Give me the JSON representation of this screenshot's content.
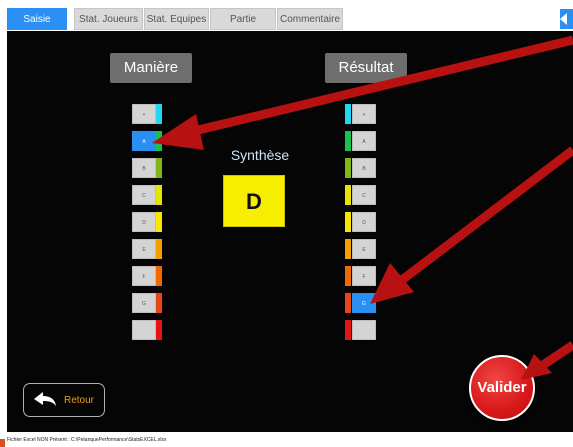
{
  "tabs": [
    {
      "label": "Saisie",
      "active": true
    },
    {
      "label": "Stat. Joueurs",
      "active": false
    },
    {
      "label": "Stat. Equipes",
      "active": false
    },
    {
      "label": "Partie",
      "active": false
    },
    {
      "label": "Commentaire",
      "active": false
    }
  ],
  "maniere": {
    "heading": "Manière",
    "options": [
      {
        "label": "+",
        "color": "#21d7f2",
        "selected": false
      },
      {
        "label": "A",
        "color": "#17c24f",
        "selected": true
      },
      {
        "label": "B",
        "color": "#7fb618",
        "selected": false
      },
      {
        "label": "C",
        "color": "#e6e400",
        "selected": false
      },
      {
        "label": "D",
        "color": "#f6e600",
        "selected": false
      },
      {
        "label": "E",
        "color": "#f2a000",
        "selected": false
      },
      {
        "label": "F",
        "color": "#ee6a00",
        "selected": false
      },
      {
        "label": "G",
        "color": "#e8471a",
        "selected": false
      },
      {
        "label": "",
        "color": "#e81212",
        "selected": false
      }
    ]
  },
  "resultat": {
    "heading": "Résultat",
    "options": [
      {
        "label": "+",
        "color": "#21d7f2",
        "selected": false
      },
      {
        "label": "A",
        "color": "#17c24f",
        "selected": false
      },
      {
        "label": "B",
        "color": "#7fb618",
        "selected": false
      },
      {
        "label": "C",
        "color": "#e6e400",
        "selected": false
      },
      {
        "label": "D",
        "color": "#f6e600",
        "selected": false
      },
      {
        "label": "E",
        "color": "#f2a000",
        "selected": false
      },
      {
        "label": "F",
        "color": "#ee6a00",
        "selected": false
      },
      {
        "label": "G",
        "color": "#e8471a",
        "selected": true
      },
      {
        "label": "",
        "color": "#e81212",
        "selected": false
      }
    ]
  },
  "synthese": {
    "label": "Synthèse",
    "value": "D",
    "color": "#f8ee00"
  },
  "retour": {
    "label": "Retour",
    "icon": "back-arrow-icon"
  },
  "valider": {
    "label": "Valider"
  },
  "statusbar": {
    "text": "Fichier Excel NON Présent : C:\\PetanquePerformance\\StatsEXCEL.xlsx"
  },
  "colors": {
    "accent": "#2a8ef2",
    "annotation_arrow": "#b81111",
    "background": "#050505"
  }
}
